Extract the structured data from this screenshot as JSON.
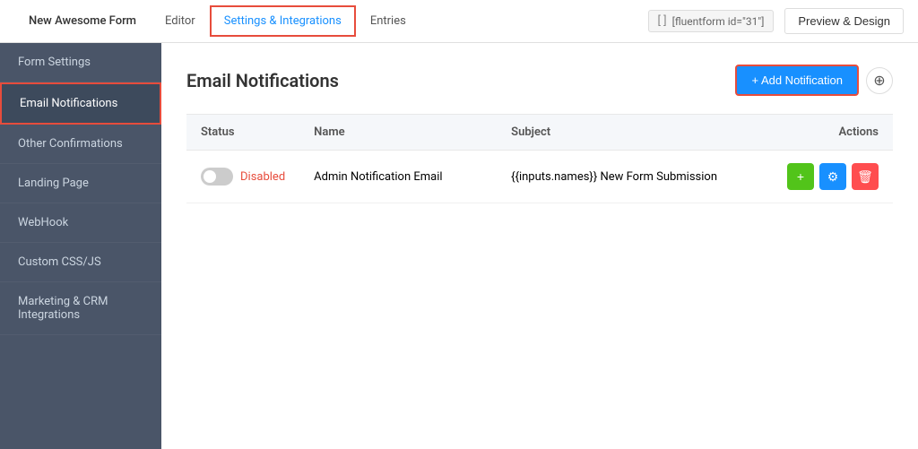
{
  "top_nav": {
    "form_name": "New Awesome Form",
    "items": [
      {
        "id": "editor",
        "label": "Editor",
        "active": false
      },
      {
        "id": "settings",
        "label": "Settings & Integrations",
        "active": true
      },
      {
        "id": "entries",
        "label": "Entries",
        "active": false
      }
    ],
    "shortcode": "[fluentform id=\"31\"]",
    "preview_label": "Preview & Design"
  },
  "sidebar": {
    "items": [
      {
        "id": "form-settings",
        "label": "Form Settings",
        "active": false
      },
      {
        "id": "email-notifications",
        "label": "Email Notifications",
        "active": true
      },
      {
        "id": "other-confirmations",
        "label": "Other Confirmations",
        "active": false
      },
      {
        "id": "landing-page",
        "label": "Landing Page",
        "active": false
      },
      {
        "id": "webhook",
        "label": "WebHook",
        "active": false
      },
      {
        "id": "custom-css-js",
        "label": "Custom CSS/JS",
        "active": false
      },
      {
        "id": "marketing-crm",
        "label": "Marketing & CRM Integrations",
        "active": false
      }
    ]
  },
  "main": {
    "page_title": "Email Notifications",
    "add_button_label": "+ Add Notification",
    "table": {
      "columns": [
        "Status",
        "Name",
        "Subject",
        "Actions"
      ],
      "rows": [
        {
          "status_toggle": false,
          "status_label": "Disabled",
          "name": "Admin Notification Email",
          "subject": "{{inputs.names}} New Form Submission",
          "actions": [
            "duplicate",
            "settings",
            "delete"
          ]
        }
      ]
    }
  },
  "icons": {
    "plus": "+",
    "settings": "⚙",
    "trash": "🗑",
    "copy": "❑",
    "circle_plus": "⊕",
    "shortcode": "[ ]"
  }
}
